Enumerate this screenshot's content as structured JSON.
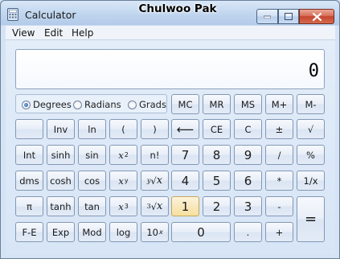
{
  "window": {
    "title": "Calculator",
    "user_label": "Chulwoo Pak"
  },
  "menu": [
    "View",
    "Edit",
    "Help"
  ],
  "display": {
    "value": "0"
  },
  "angle_mode": {
    "options": [
      "Degrees",
      "Radians",
      "Grads"
    ],
    "selected": "Degrees"
  },
  "memory_buttons": [
    "MC",
    "MR",
    "MS",
    "M+",
    "M-"
  ],
  "buttons": {
    "inv": "Inv",
    "ln": "ln",
    "lparen": "(",
    "rparen": ")",
    "backspace": "⟵",
    "ce": "CE",
    "c": "C",
    "plusminus": "±",
    "sqrt": "√",
    "int": "Int",
    "sinh": "sinh",
    "sin": "sin",
    "x2_base": "x",
    "x2_exp": "2",
    "fact": "n!",
    "n7": "7",
    "n8": "8",
    "n9": "9",
    "div": "/",
    "pct": "%",
    "dms": "dms",
    "cosh": "cosh",
    "cos": "cos",
    "xy_base": "x",
    "xy_exp": "y",
    "yroot": "∛x",
    "n4": "4",
    "n5": "5",
    "n6": "6",
    "mul": "*",
    "recip": "1/x",
    "pi": "π",
    "tanh": "tanh",
    "tan": "tan",
    "x3_base": "x",
    "x3_exp": "3",
    "cuberoot": "∛x",
    "n1": "1",
    "n2": "2",
    "n3": "3",
    "sub": "-",
    "eq": "=",
    "fe": "F-E",
    "exp": "Exp",
    "mod": "Mod",
    "log": "log",
    "tenx_base": "10",
    "tenx_exp": "x",
    "n0": "0",
    "dot": ".",
    "add": "+"
  },
  "yroot_label": {
    "pre": "y",
    "root": "√",
    "x": "x"
  },
  "cuberoot_label": {
    "pre": "3",
    "root": "√",
    "x": "x"
  }
}
